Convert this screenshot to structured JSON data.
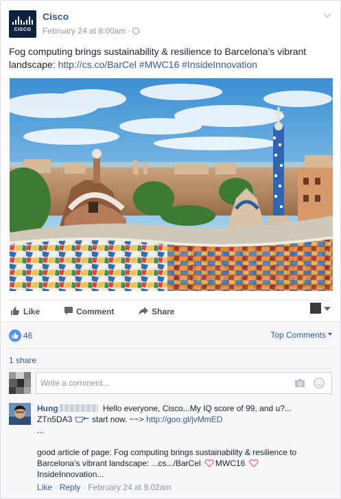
{
  "post": {
    "page_name": "Cisco",
    "logo_text": "CISCO",
    "timestamp": "February 24 at 8:00am",
    "meta_dot": "·",
    "privacy_icon": "globe-icon",
    "text_plain": "Fog computing brings sustainability & resilience to Barcelona’s vibrant landscape: ",
    "link": "http://cs.co/BarCel",
    "hashtag1": "#MWC16",
    "hashtag2": "#InsideInnovation"
  },
  "actions": {
    "like": "Like",
    "comment": "Comment",
    "share": "Share"
  },
  "feedback": {
    "like_count": "46",
    "sort_label": "Top Comments",
    "shares": "1 share",
    "comment_placeholder": "Write a comment..."
  },
  "comment": {
    "author": "Hung",
    "line1": "Hello everyone, Cisco...My IQ score of 99, and u?...",
    "line2a": "ZTn5DA3",
    "line2b": " start now. ~~> ",
    "link": "http://goo.gl/jvMmED",
    "line3": "...",
    "para2a": "good article of page: Fog computing brings sustainability & resilience to Barcelona’s vibrant landscape: ...cs.../BarCel",
    "para2b": "MWC16",
    "para2c": "InsideInnovation...",
    "like": "Like",
    "reply": "Reply",
    "sep": "·",
    "time": "February 24 at 9:02am"
  },
  "colors": {
    "link": "#365899",
    "muted": "#90949c",
    "like_badge": "#5890ff",
    "heart": "#e9737d"
  }
}
